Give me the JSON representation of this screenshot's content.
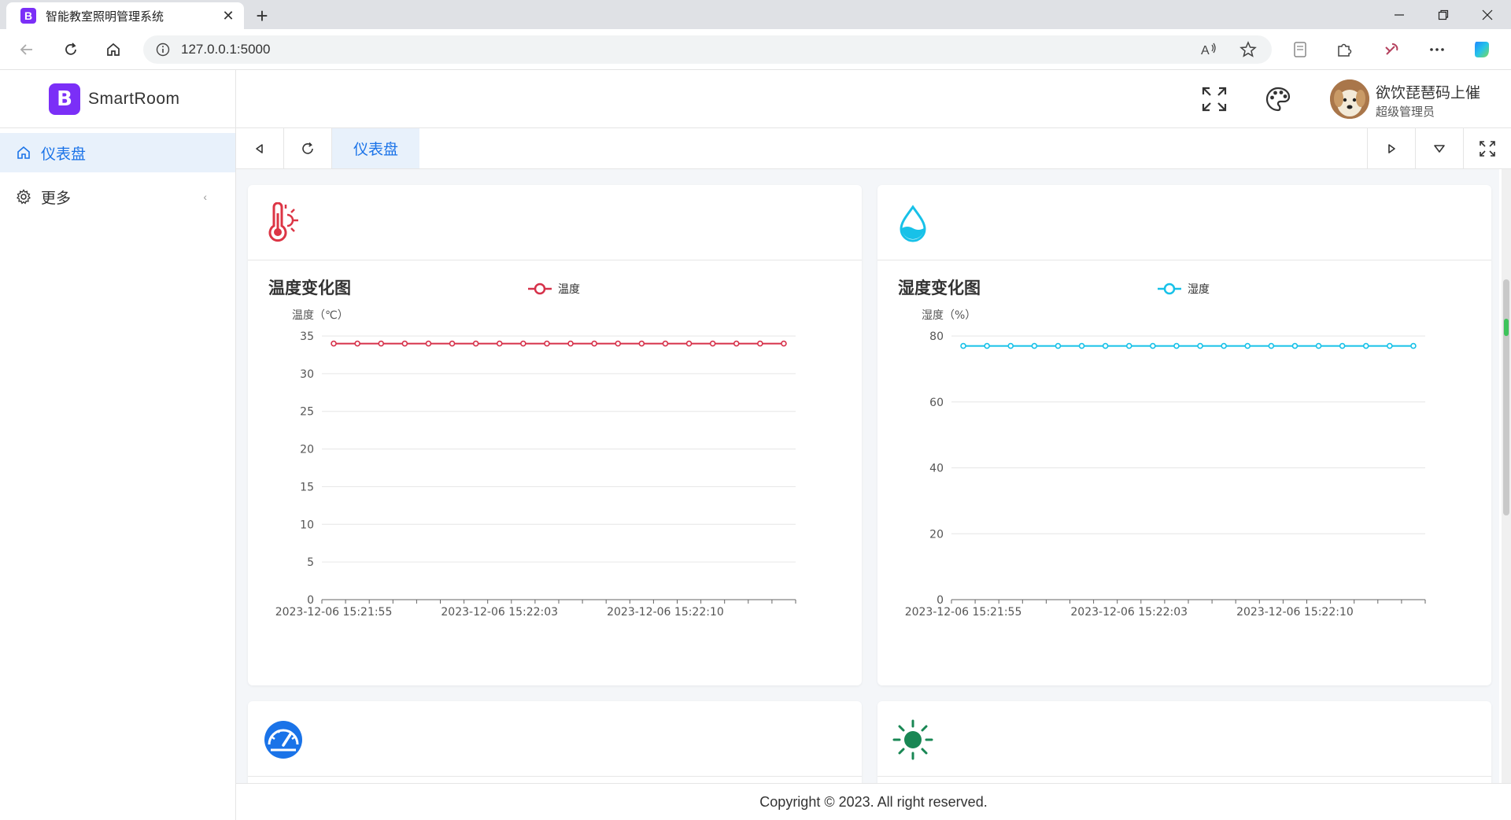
{
  "browser": {
    "tab_title": "智能教室照明管理系统",
    "favicon_letter": "B",
    "url": "127.0.0.1:5000"
  },
  "app": {
    "logo_letter": "B",
    "logo_text": "SmartRoom",
    "brand_color": "#7b2ff7",
    "accent_color": "#1a73e8"
  },
  "sidebar": {
    "items": [
      {
        "label": "仪表盘",
        "icon": "home-icon",
        "active": true
      },
      {
        "label": "更多",
        "icon": "gear-icon",
        "active": false,
        "arrow": "‹"
      }
    ]
  },
  "header": {
    "user_name": "欲饮琵琶码上催",
    "user_role": "超级管理员"
  },
  "tabs": {
    "active_label": "仪表盘"
  },
  "footer": {
    "text": "Copyright © 2023. All right reserved."
  },
  "cards": [
    {
      "icon": "thermometer-icon",
      "icon_color": "#dc3545"
    },
    {
      "icon": "water-drop-icon",
      "icon_color": "#17c1e8"
    },
    {
      "icon": "gauge-icon",
      "icon_color": "#1a73e8"
    },
    {
      "icon": "sun-icon",
      "icon_color": "#198754"
    }
  ],
  "chart_data": [
    {
      "type": "line",
      "title": "温度变化图",
      "ylabel": "温度（℃）",
      "legend": "温度",
      "color": "#d6314a",
      "ylim": [
        0,
        35
      ],
      "yticks": [
        0,
        5,
        10,
        15,
        20,
        25,
        30,
        35
      ],
      "x_tick_labels": [
        "2023-12-06 15:21:55",
        "2023-12-06 15:22:03",
        "2023-12-06 15:22:10"
      ],
      "series": [
        {
          "name": "温度",
          "values": [
            34,
            34,
            34,
            34,
            34,
            34,
            34,
            34,
            34,
            34,
            34,
            34,
            34,
            34,
            34,
            34,
            34,
            34,
            34,
            34
          ]
        }
      ]
    },
    {
      "type": "line",
      "title": "湿度变化图",
      "ylabel": "湿度（%）",
      "legend": "湿度",
      "color": "#17c1e8",
      "ylim": [
        0,
        80
      ],
      "yticks": [
        0,
        20,
        40,
        60,
        80
      ],
      "x_tick_labels": [
        "2023-12-06 15:21:55",
        "2023-12-06 15:22:03",
        "2023-12-06 15:22:10"
      ],
      "series": [
        {
          "name": "湿度",
          "values": [
            77,
            77,
            77,
            77,
            77,
            77,
            77,
            77,
            77,
            77,
            77,
            77,
            77,
            77,
            77,
            77,
            77,
            77,
            77,
            77
          ]
        }
      ]
    }
  ]
}
